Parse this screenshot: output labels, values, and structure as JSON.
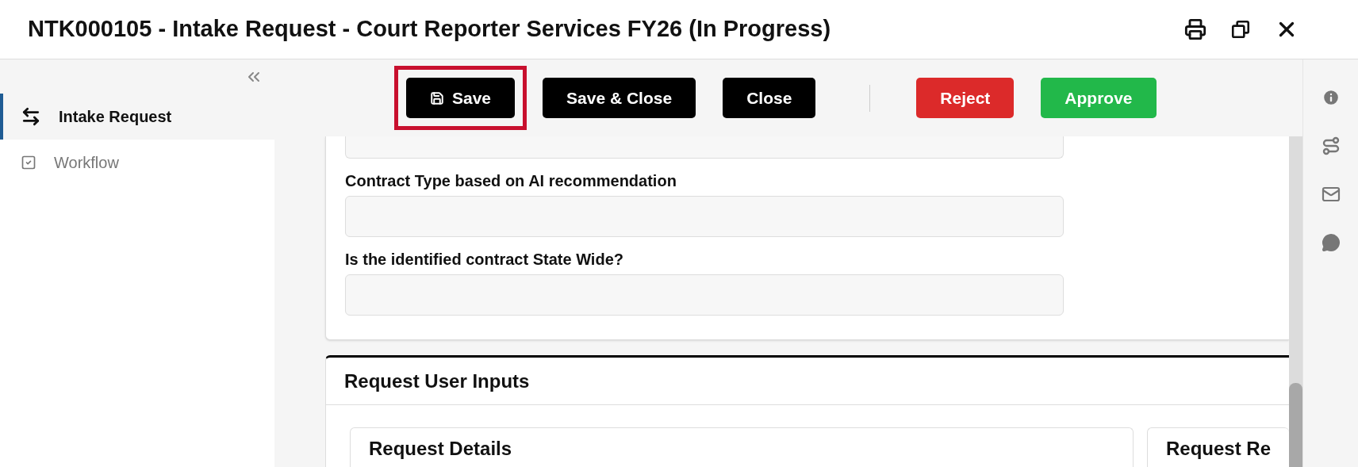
{
  "window": {
    "title": "NTK000105 - Intake Request - Court Reporter Services FY26 (In Progress)"
  },
  "sidebar": {
    "items": [
      {
        "label": "Intake Request",
        "selected": true
      },
      {
        "label": "Workflow",
        "selected": false
      }
    ]
  },
  "toolbar": {
    "buttons": [
      {
        "label": "Save",
        "kind": "dark",
        "highlighted": true
      },
      {
        "label": "Save & Close",
        "kind": "dark",
        "highlighted": false
      },
      {
        "label": "Close",
        "kind": "dark",
        "highlighted": false
      },
      {
        "kind": "divider"
      },
      {
        "label": "Reject",
        "kind": "danger",
        "highlighted": false
      },
      {
        "label": "Approve",
        "kind": "success",
        "highlighted": false
      }
    ]
  },
  "form": {
    "fields": [
      {
        "label": "Contract Type based on AI recommendation"
      },
      {
        "label": "Is the identified contract State Wide?"
      }
    ]
  },
  "section": {
    "title": "Request User Inputs",
    "panels": [
      {
        "title": "Request Details"
      },
      {
        "title": "Request Re"
      }
    ]
  }
}
